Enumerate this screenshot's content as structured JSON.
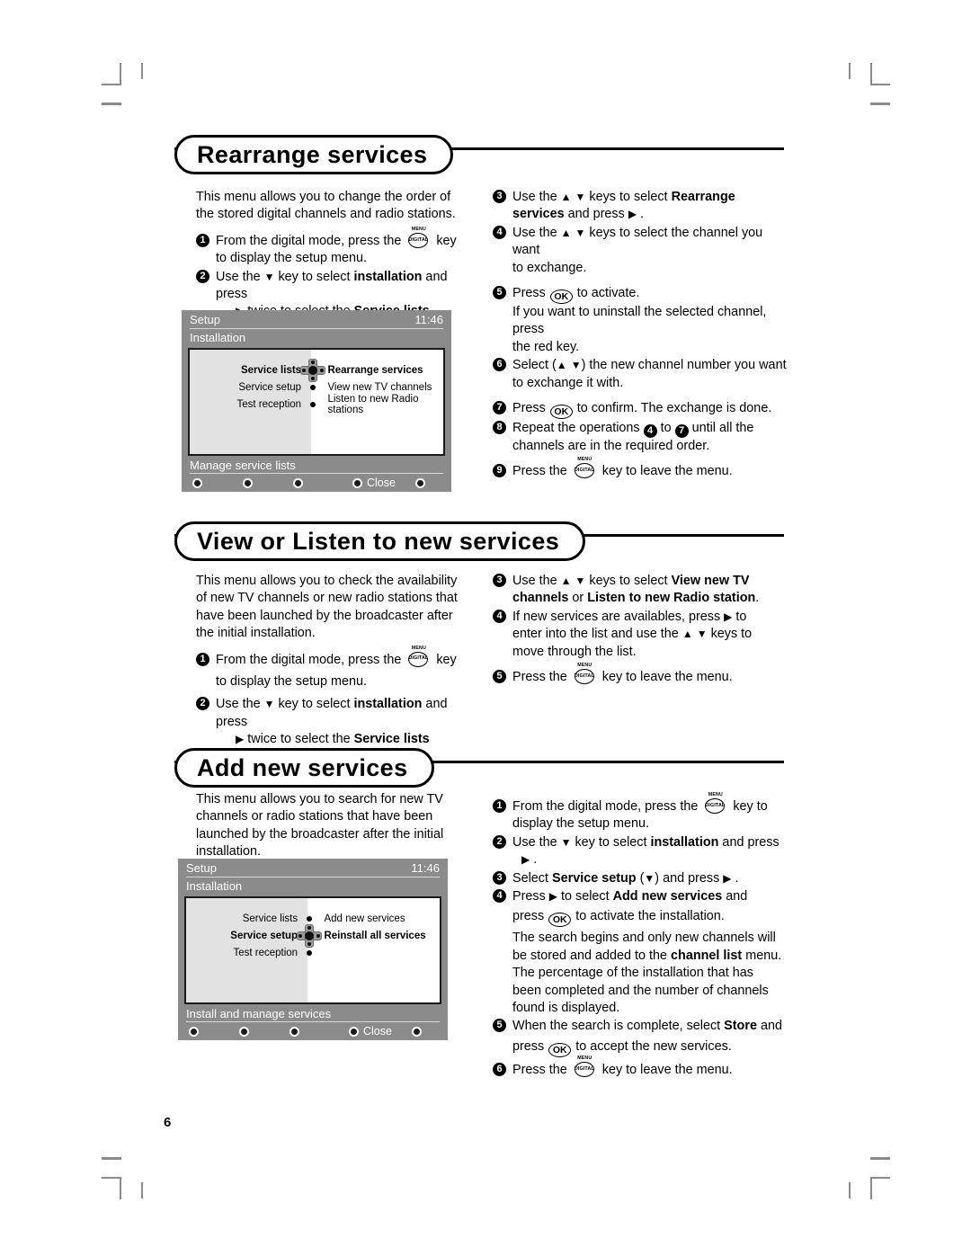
{
  "page": {
    "number": "6"
  },
  "sections": [
    {
      "id": "rearrange",
      "title": "Rearrange services",
      "intro": "This menu allows you to change the order of the stored digital channels and radio stations.",
      "left_steps": [
        {
          "num": "1",
          "html": "From the digital mode, press the [MENUKEY] key to display the setup menu."
        },
        {
          "num": "2",
          "html": "Use the ▼ key to select installation and press ▶ twice to select the Service lists menu."
        }
      ],
      "right_steps": [
        {
          "num": "3",
          "text": "Use the ▲ ▼ keys to select Rearrange services and press ▶ ."
        },
        {
          "num": "4",
          "text": "Use the ▲ ▼ keys to select the channel you want to exchange."
        },
        {
          "num": "5",
          "text": "Press OK to activate. If you want to uninstall the selected channel, press the red key."
        },
        {
          "num": "6",
          "text": "Select (▲ ▼) the new channel number you want to exchange it with."
        },
        {
          "num": "7",
          "text": "Press OK to confirm. The exchange is done."
        },
        {
          "num": "8",
          "text": "Repeat the operations 4 to 7 until all the channels are in the required order."
        },
        {
          "num": "9",
          "text": "Press the MENU DIGITAL key to leave the menu."
        }
      ]
    },
    {
      "id": "view-listen",
      "title": "View or Listen to new  services",
      "intro": "This menu allows you to check the availability of new TV channels or new radio stations that have been launched by the broadcaster after the initial installation.",
      "left_steps": [
        {
          "num": "1",
          "html": "From the digital mode, press the [MENUKEY] key to display the setup menu."
        },
        {
          "num": "2",
          "html": "Use the ▼ key to select installation and press ▶ twice to select the Service lists menu."
        }
      ],
      "right_steps": [
        {
          "num": "3",
          "text": "Use the ▲ ▼ keys to select View new TV channels or Listen to new Radio station."
        },
        {
          "num": "4",
          "text": "If new services are availables, press ▶ to enter into the list and use the ▲ ▼ keys to move through the list."
        },
        {
          "num": "5",
          "text": "Press the MENU DIGITAL key to leave the menu."
        }
      ]
    },
    {
      "id": "add-new",
      "title": "Add new services",
      "intro": "This menu allows you to search for new TV channels or radio stations that have been launched by the broadcaster after the initial installation.",
      "right_steps": [
        {
          "num": "1",
          "text": "From the digital mode, press the MENU DIGITAL key to display the setup menu."
        },
        {
          "num": "2",
          "text": "Use the ▼ key to select installation and press ▶ ."
        },
        {
          "num": "3",
          "text": "Select Service setup (▼) and press ▶ ."
        },
        {
          "num": "4",
          "text": "Press ▶ to select Add new services and press OK to activate the installation. The search begins and only new channels will be stored and added to the channel list menu. The percentage of the installation that has been completed and the number of channels found is displayed."
        },
        {
          "num": "5",
          "text": "When the search is complete, select Store and press OK to accept the new services."
        },
        {
          "num": "6",
          "text": "Press the MENU DIGITAL key to leave the menu."
        }
      ]
    }
  ],
  "osd1": {
    "title": "Setup",
    "clock": "11:46",
    "subtitle": "Installation",
    "rows": [
      {
        "left": "Service lists",
        "right": "Rearrange services",
        "selected": true
      },
      {
        "left": "Service setup",
        "right": "View new TV channels",
        "selected": false
      },
      {
        "left": "Test reception",
        "right": "Listen to new Radio stations",
        "selected": false
      }
    ],
    "footer_label": "Manage service lists",
    "close_label": "Close"
  },
  "osd2": {
    "title": "Setup",
    "clock": "11:46",
    "subtitle": "Installation",
    "rows": [
      {
        "left": "Service lists",
        "right": "Add new services",
        "selected": false
      },
      {
        "left": "Service setup",
        "right": "Reinstall all services",
        "selected": true
      },
      {
        "left": "Test reception",
        "right": "",
        "selected": false
      }
    ],
    "footer_label": "Install and manage services",
    "close_label": "Close"
  },
  "keys": {
    "menu_top": "MENU",
    "digital": "DIGITAL",
    "ok": "OK"
  },
  "colors": {
    "osd_background": "#8b8b8b",
    "osd_panel": "#ffffff",
    "osd_shade": "#e2e2e2",
    "crop_mark": "#8a8a8a",
    "text": "#000000"
  }
}
